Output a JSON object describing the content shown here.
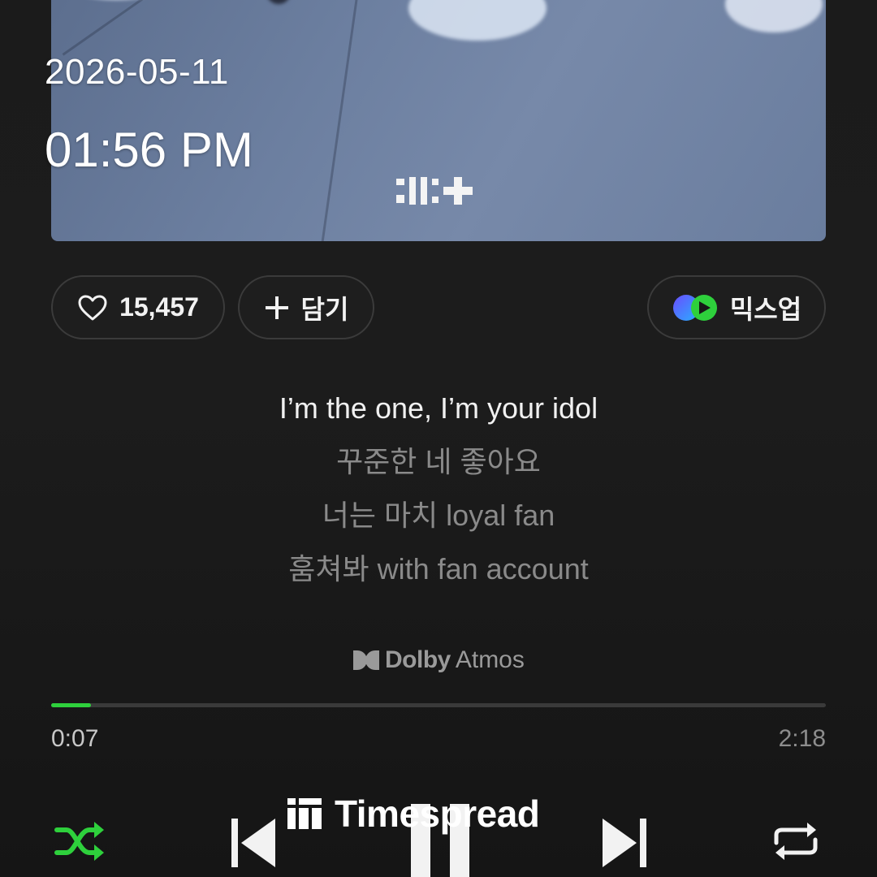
{
  "overlay": {
    "date": "2026-05-11",
    "time": "01:56 PM"
  },
  "actions": {
    "like_count": "15,457",
    "add_label": "담기",
    "mixup_label": "믹스업"
  },
  "lyrics": [
    {
      "text": "I’m the one, I’m your idol",
      "current": true
    },
    {
      "text": "꾸준한 네 좋아요",
      "current": false
    },
    {
      "text": "너는 마치 loyal fan",
      "current": false
    },
    {
      "text": "훔쳐봐 with fan account",
      "current": false
    }
  ],
  "dolby": {
    "brand": "Dolby",
    "product": "Atmos"
  },
  "playback": {
    "elapsed": "0:07",
    "total": "2:18",
    "progress_fraction": 0.051
  },
  "watermark": {
    "text": "Timespread"
  },
  "icons": {
    "like": "heart-icon",
    "add": "plus-icon",
    "mixup": "mixup-icon",
    "shuffle": "shuffle-icon",
    "previous": "skip-previous-icon",
    "pause": "pause-icon",
    "next": "skip-next-icon",
    "repeat": "repeat-icon",
    "dolby": "dolby-logo-icon"
  },
  "colors": {
    "accent": "#2ed03c",
    "background": "#1b1b1b",
    "lyric_current": "#f1f1f1",
    "lyric_dim": "#8a8a8a"
  }
}
